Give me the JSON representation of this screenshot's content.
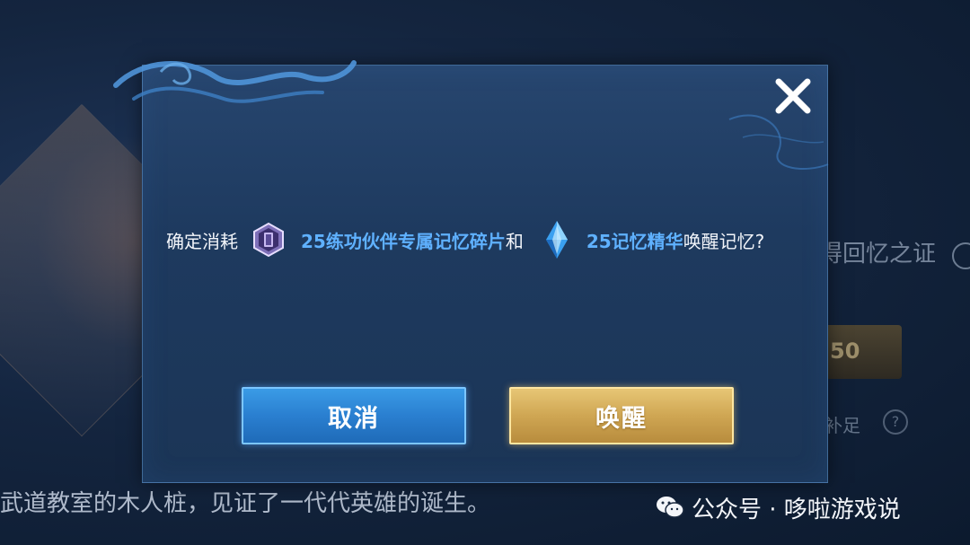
{
  "background": {
    "side_label": "得回忆之证",
    "side_button_value": "50",
    "side_small_label": "补足",
    "side_help": "?",
    "bottom_text": "武道教室的木人桩，见证了一代代英雄的诞生。"
  },
  "dialog": {
    "message": {
      "prefix": "确定消耗",
      "item1": "25练功伙伴专属记忆碎片",
      "connector": "和",
      "item2": "25记忆精华",
      "suffix": "唤醒记忆?"
    },
    "icons": {
      "item1": "memory-fragment-icon",
      "item2": "memory-crystal-icon",
      "close": "close-icon"
    },
    "buttons": {
      "cancel": "取消",
      "confirm": "唤醒"
    }
  },
  "watermark": {
    "text": "公众号 · 哆啦游戏说",
    "icon": "wechat-icon"
  },
  "colors": {
    "highlight": "#5fb1ff",
    "cancel_button": "#2a7fd0",
    "confirm_button": "#cfa653",
    "dialog_bg": "#1e3a5f"
  }
}
